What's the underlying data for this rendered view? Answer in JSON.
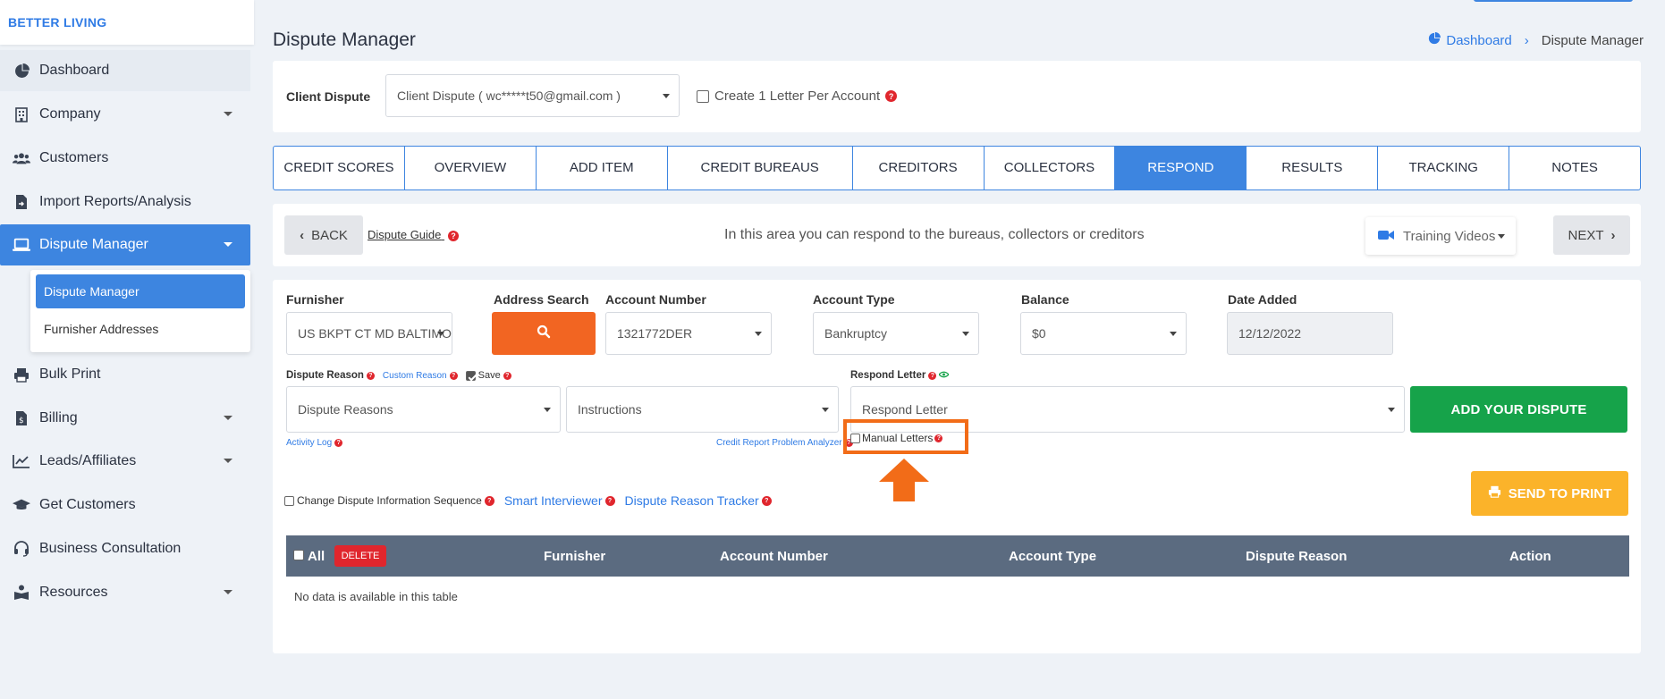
{
  "brand": "BETTER LIVING",
  "sidebar": {
    "items": [
      {
        "label": "Dashboard",
        "icon": "pie-chart-icon"
      },
      {
        "label": "Company",
        "icon": "building-icon",
        "has_caret": true
      },
      {
        "label": "Customers",
        "icon": "users-icon"
      },
      {
        "label": "Import Reports/Analysis",
        "icon": "file-import-icon"
      },
      {
        "label": "Dispute Manager",
        "icon": "laptop-icon",
        "has_caret": true,
        "active": true
      },
      {
        "label": "Bulk Print",
        "icon": "printer-icon"
      },
      {
        "label": "Billing",
        "icon": "invoice-icon",
        "has_caret": true
      },
      {
        "label": "Leads/Affiliates",
        "icon": "chart-line-icon",
        "has_caret": true
      },
      {
        "label": "Get Customers",
        "icon": "graduation-cap-icon"
      },
      {
        "label": "Business Consultation",
        "icon": "headset-icon"
      },
      {
        "label": "Resources",
        "icon": "book-reader-icon",
        "has_caret": true
      }
    ],
    "submenu": [
      "Dispute Manager",
      "Furnisher Addresses"
    ]
  },
  "header": {
    "title": "Dispute Manager",
    "breadcrumb": [
      "Dashboard",
      "Dispute Manager"
    ]
  },
  "client": {
    "label": "Client Dispute",
    "value": "Client Dispute ( wc*****t50@gmail.com )",
    "checkbox_label": "Create 1 Letter Per Account"
  },
  "tabs": [
    {
      "label": "CREDIT SCORES"
    },
    {
      "label": "OVERVIEW"
    },
    {
      "label": "ADD ITEM"
    },
    {
      "label": "CREDIT BUREAUS"
    },
    {
      "label": "CREDITORS"
    },
    {
      "label": "COLLECTORS"
    },
    {
      "label": "RESPOND",
      "active": true
    },
    {
      "label": "RESULTS"
    },
    {
      "label": "TRACKING"
    },
    {
      "label": "NOTES"
    }
  ],
  "nav": {
    "back": "BACK",
    "guide": "Dispute Guide",
    "info": "In this area you can respond to the bureaus, collectors or creditors",
    "training": "Training Videos",
    "next": "NEXT"
  },
  "form": {
    "furnisher_label": "Furnisher",
    "furnisher_value": "US BKPT CT MD BALTIMOR",
    "address_search_label": "Address Search",
    "account_number_label": "Account Number",
    "account_number_value": "1321772DER",
    "account_type_label": "Account Type",
    "account_type_value": "Bankruptcy",
    "balance_label": "Balance",
    "balance_value": "$0",
    "date_added_label": "Date Added",
    "date_added_value": "12/12/2022",
    "dispute_reason_label": "Dispute Reason",
    "custom_reason": "Custom Reason",
    "save_label": "Save",
    "respond_letter_label": "Respond Letter",
    "dispute_reasons_value": "Dispute Reasons",
    "instructions_value": "Instructions",
    "respond_letter_value": "Respond Letter",
    "add_dispute": "ADD YOUR DISPUTE",
    "activity_log": "Activity Log",
    "credit_report_analyzer": "Credit Report Problem Analyzer",
    "manual_letters": "Manual Letters",
    "change_sequence": "Change Dispute Information Sequence",
    "smart_interviewer": "Smart Interviewer",
    "reason_tracker": "Dispute Reason Tracker",
    "send_to_print": "SEND TO PRINT"
  },
  "table": {
    "all_label": "All",
    "delete_label": "DELETE",
    "columns": [
      "Furnisher",
      "Account Number",
      "Account Type",
      "Dispute Reason",
      "Action"
    ],
    "empty": "No data is available in this table"
  },
  "colors": {
    "primary": "#3d85e0",
    "orange": "#f26522",
    "green": "#16a34a",
    "yellow": "#fbb32a",
    "danger": "#e0262d"
  }
}
